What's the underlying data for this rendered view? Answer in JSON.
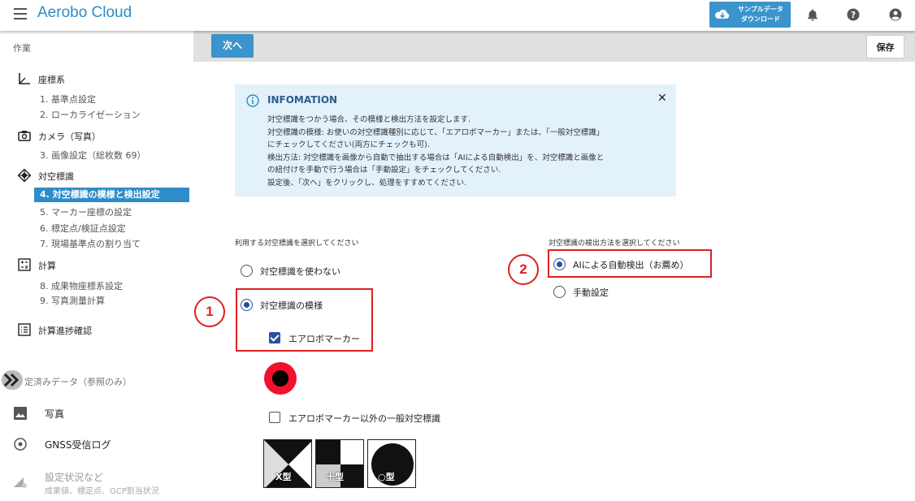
{
  "header": {
    "app_title": "Aerobo Cloud",
    "download_button": {
      "line1": "サンプルデータ",
      "line2": "ダウンロード"
    },
    "icons": [
      "menu-icon",
      "cloud-download-icon",
      "bell-icon",
      "help-icon",
      "account-icon"
    ]
  },
  "sidebar": {
    "work_label": "作業",
    "sections": [
      {
        "icon": "axis-icon",
        "label": "座標系",
        "items": [
          "1. 基準点設定",
          "2. ローカライゼーション"
        ]
      },
      {
        "icon": "camera-icon",
        "label": "カメラ（写真）",
        "items": [
          "3. 画像設定（総枚数 69）"
        ]
      },
      {
        "icon": "target-marker-icon",
        "label": "対空標識",
        "items": [
          "4. 対空標識の模様と検出設定",
          "5. マーカー座標の設定",
          "6. 標定点/検証点設定",
          "7. 現場基準点の割り当て"
        ]
      },
      {
        "icon": "calculator-icon",
        "label": "計算",
        "items": [
          "8. 成果物座標系設定",
          "9. 写真測量計算"
        ]
      },
      {
        "icon": "list-icon",
        "label": "計算進捗確認",
        "items": []
      }
    ],
    "active_item": "4. 対空標識の模様と検出設定",
    "reference_label": "定済みデータ（参照のみ）",
    "photo_label": "写真",
    "gnss_label": "GNSS受信ログ",
    "settings_label": "設定状況など",
    "settings_sub": "成果値、標定点、GCP割当状況"
  },
  "toolbar": {
    "next_label": "次へ",
    "save_label": "保存"
  },
  "info": {
    "title": "INFOMATION",
    "lines": [
      "対空標識をつかう場合、その模様と検出方法を設定します.",
      "対空標識の模様: お使いの対空標識種別に応じて、「エアロボマーカー」または、「一般対空標識」",
      "にチェックしてください(両方にチェックも可).",
      "検出方法: 対空標識を画像から自動で抽出する場合は「AIによる自動検出」を、対空標識と画像と",
      "の紐付けを手動で行う場合は「手動設定」をチェックしてください.",
      "設定後、「次へ」をクリックし、処理をすすめてください."
    ]
  },
  "marker_section": {
    "label": "利用する対空標識を選択してください",
    "option_none": "対空標識を使わない",
    "option_pattern": "対空標識の模様",
    "check_aerobo": "エアロボマーカー",
    "check_general": "エアロボマーカー以外の一般対空標識",
    "pattern_x": "X型",
    "pattern_plus": "十型",
    "pattern_o": "○型"
  },
  "detect_section": {
    "label": "対空標識の検出方法を選択してください",
    "option_ai": "AIによる自動検出（お薦め）",
    "option_manual": "手動設定"
  },
  "annotations": {
    "num1": "1",
    "num2": "2",
    "color": "#e02020"
  },
  "colors": {
    "accent": "#2f8cc9",
    "radio_selected": "#2a4fa0",
    "info_bg": "#e3f1fb",
    "marker_red": "#f2102a"
  }
}
